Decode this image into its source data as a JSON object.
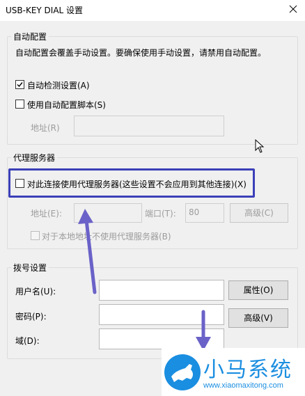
{
  "window": {
    "title": "USB-KEY DIAL 设置"
  },
  "auto_config": {
    "legend": "自动配置",
    "description": "自动配置会覆盖手动设置。要确保使用手动设置，请禁用自动配置。",
    "auto_detect_label": "自动检测设置(A)",
    "auto_detect_checked": true,
    "use_script_label": "使用自动配置脚本(S)",
    "use_script_checked": false,
    "address_label": "地址(R)",
    "address_value": ""
  },
  "proxy": {
    "legend": "代理服务器",
    "use_proxy_label": "对此连接使用代理服务器(这些设置不会应用到其他连接)(X)",
    "use_proxy_checked": false,
    "address_label": "地址(E):",
    "address_value": "",
    "port_label": "端口(T):",
    "port_value": "80",
    "advanced_label": "高级(C)",
    "bypass_local_label": "对于本地地址不使用代理服务器(B)",
    "bypass_local_checked": false
  },
  "dial": {
    "legend": "拨号设置",
    "username_label": "用户名(U):",
    "username_value": "",
    "properties_label": "属性(O)",
    "password_label": "密码(P):",
    "password_value": "",
    "advanced_label": "高级(V)",
    "domain_label": "域(D):",
    "domain_value": ""
  },
  "watermark": {
    "title": "小马系统",
    "url": "www.xiaomaxitong.com"
  },
  "colors": {
    "highlight": "#3b3fb8",
    "arrow": "#6a62c8",
    "watermark": "#1a8ee0"
  }
}
